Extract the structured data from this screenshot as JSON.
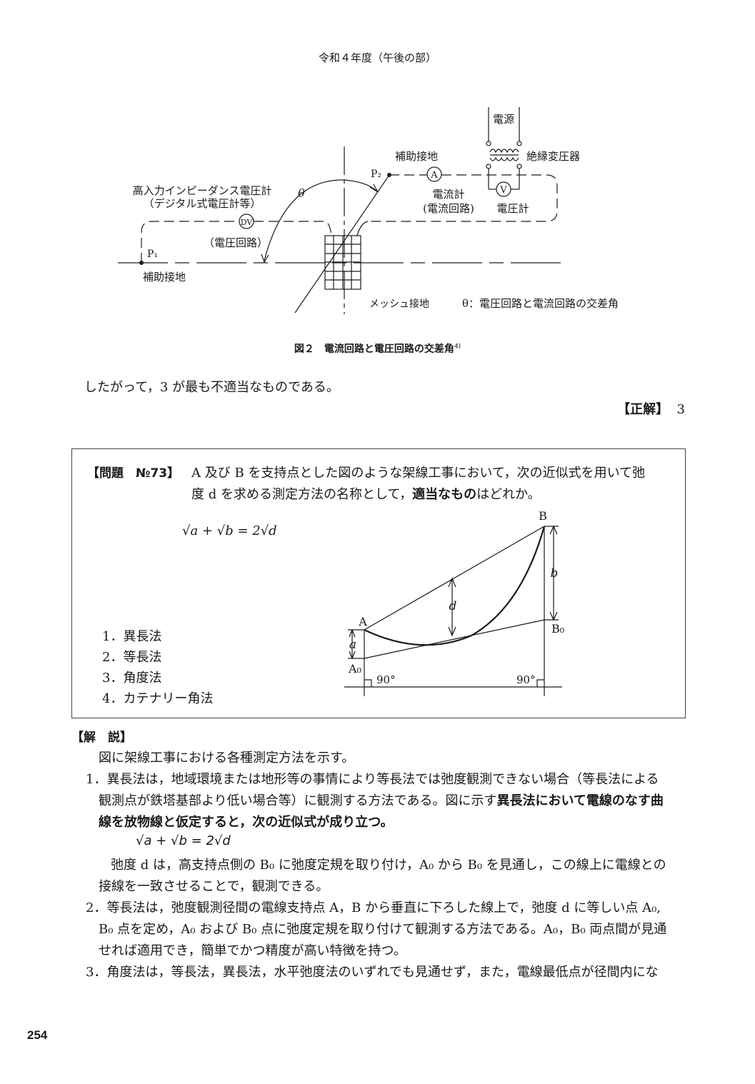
{
  "header": "令和４年度（午後の部）",
  "figure2": {
    "power_source": "電源",
    "transformer": "絶縁変圧器",
    "aux_ground_top": "補助接地",
    "p2": "P₂",
    "ammeter_symbol": "A",
    "voltmeter_symbol": "V",
    "ammeter": "電流計",
    "current_circuit": "(電流回路)",
    "voltmeter": "電圧計",
    "hi_z_voltmeter": "高入力インピーダンス電圧計",
    "digital_voltmeter": "（デジタル式電圧計等）",
    "theta": "θ",
    "dv_symbol": "DV",
    "voltage_circuit": "（電圧回路）",
    "p1": "P₁",
    "aux_ground_bottom": "補助接地",
    "mesh_ground": "メッシュ接地",
    "theta_legend": "θ：電圧回路と電流回路の交差角",
    "caption": "図２　電流回路と電圧回路の交差角",
    "caption_ref": "4)"
  },
  "conclusion": "したがって，3 が最も不適当なものである。",
  "answer": {
    "label": "【正解】",
    "value": "3"
  },
  "question": {
    "number": "【問題　№73】",
    "line1": "A 及び B を支持点とした図のような架線工事において，次の近似式を用いて弛",
    "line2_a": "度 d を求める測定方法の名称として，",
    "line2_bold": "適当なもの",
    "line2_b": "はどれか。",
    "formula": "√a + √b = 2√d",
    "options": [
      "1．異長法",
      "2．等長法",
      "3．角度法",
      "4．カテナリー角法"
    ],
    "diagram": {
      "B": "B",
      "A": "A",
      "A0": "A₀",
      "B0": "B₀",
      "a": "a",
      "b": "b",
      "d": "d",
      "angle_left": "90°",
      "angle_right": "90°"
    }
  },
  "explanation": {
    "heading": "【解　説】",
    "intro": "図に架線工事における各種測定方法を示す。",
    "item1_l1": "1．異長法は，地域環境または地形等の事情により等長法では弛度観測できない場合（等長法による",
    "item1_l2a": "観測点が鉄塔基部より低い場合等）に観測する方法である。図に示す",
    "item1_l2b": "異長法において電線のなす曲",
    "item1_l3": "線を放物線と仮定すると，次の近似式が成り立つ。",
    "formula": "√a + √b = 2√d",
    "item1_l4": "弛度 d は，高支持点側の B₀ に弛度定規を取り付け，A₀ から B₀ を見通し，この線上に電線との",
    "item1_l5": "接線を一致させることで，観測できる。",
    "item2_l1": "2．等長法は，弛度観測径間の電線支持点 A，B から垂直に下ろした線上で，弛度 d に等しい点 A₀,",
    "item2_l2": "B₀ 点を定め，A₀ および B₀ 点に弛度定規を取り付けて観測する方法である。A₀，B₀ 両点間が見通",
    "item2_l3": "せれば適用でき，簡単でかつ精度が高い特徴を持つ。",
    "item3_l1": "3．角度法は，等長法，異長法，水平弛度法のいずれでも見通せず，また，電線最低点が径間内にな"
  },
  "page_number": "254"
}
